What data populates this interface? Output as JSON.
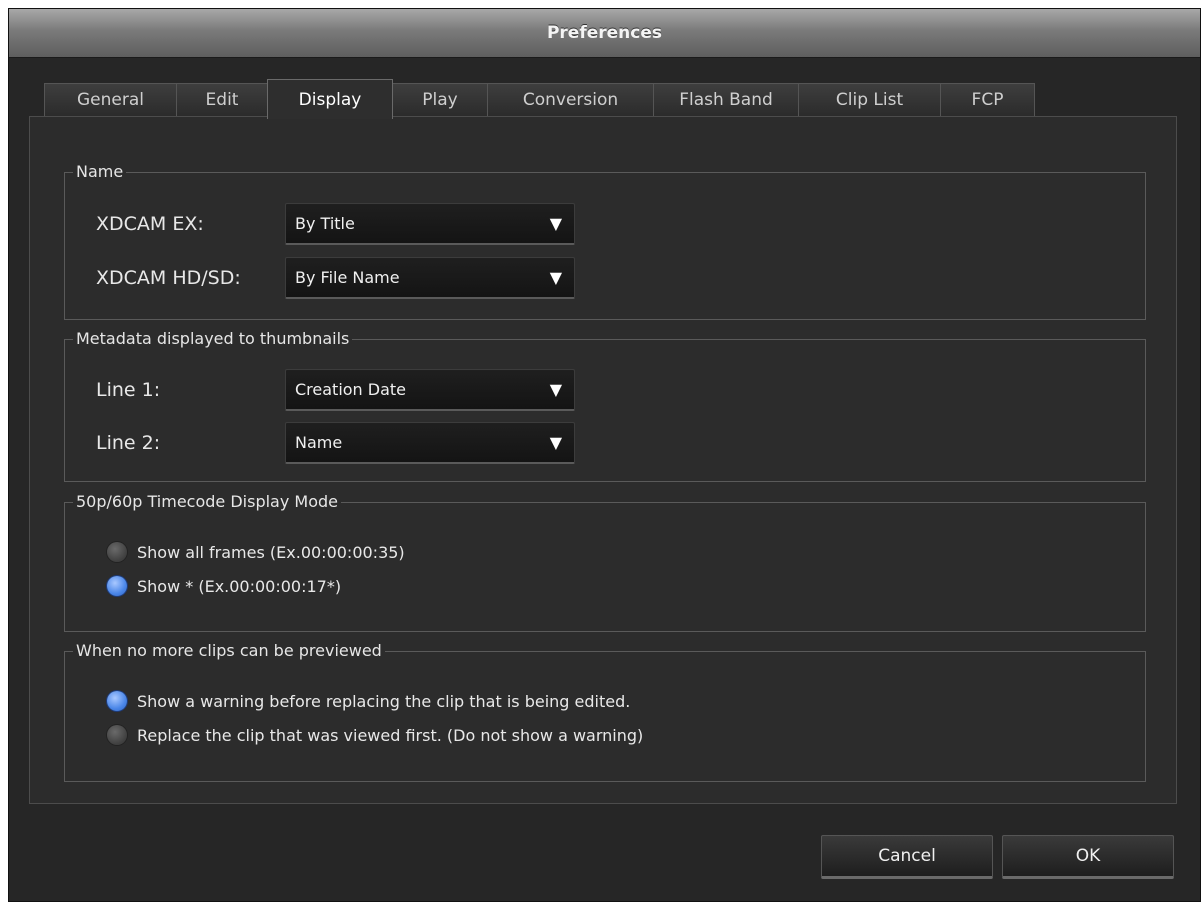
{
  "window": {
    "title": "Preferences"
  },
  "tabs": [
    {
      "label": "General",
      "active": false
    },
    {
      "label": "Edit",
      "active": false
    },
    {
      "label": "Display",
      "active": true
    },
    {
      "label": "Play",
      "active": false
    },
    {
      "label": "Conversion",
      "active": false
    },
    {
      "label": "Flash Band",
      "active": false
    },
    {
      "label": "Clip List",
      "active": false
    },
    {
      "label": "FCP",
      "active": false
    }
  ],
  "name_group": {
    "legend": "Name",
    "xdcam_ex": {
      "label": "XDCAM EX:",
      "value": "By Title"
    },
    "xdcam_hdsd": {
      "label": "XDCAM HD/SD:",
      "value": "By File Name"
    }
  },
  "metadata_group": {
    "legend": "Metadata displayed to thumbnails",
    "line1": {
      "label": "Line 1:",
      "value": "Creation Date"
    },
    "line2": {
      "label": "Line 2:",
      "value": "Name"
    }
  },
  "timecode_group": {
    "legend": "50p/60p Timecode Display Mode",
    "options": [
      {
        "label": "Show all frames (Ex.00:00:00:35)",
        "checked": false
      },
      {
        "label": "Show * (Ex.00:00:00:17*)",
        "checked": true
      }
    ]
  },
  "preview_group": {
    "legend": "When no more clips can be previewed",
    "options": [
      {
        "label": "Show a warning before replacing the clip that is being edited.",
        "checked": true
      },
      {
        "label": "Replace the clip that was viewed first. (Do not show a warning)",
        "checked": false
      }
    ]
  },
  "dropdown_arrow": "▼",
  "buttons": {
    "cancel": "Cancel",
    "ok": "OK"
  },
  "colors": {
    "accent": "#4a86e8",
    "background": "#262626"
  }
}
